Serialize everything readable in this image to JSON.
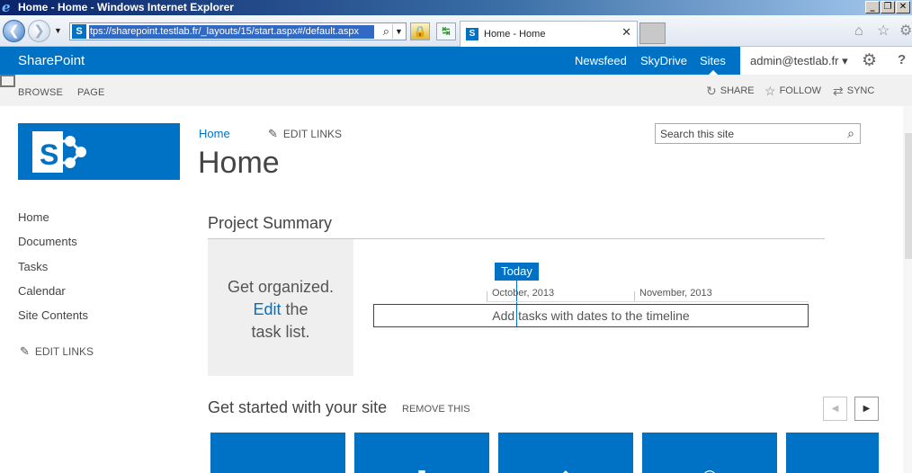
{
  "browser": {
    "window_title": "Home - Home - Windows Internet Explorer",
    "window_buttons": {
      "minimize": "_",
      "restore": "❐",
      "close": "✕"
    },
    "address_url": "tps://sharepoint.testlab.fr/_layouts/15/start.aspx#/default.aspx",
    "site_favicon": "S",
    "tab_title": "Home - Home",
    "tab_close": "✕",
    "back_glyph": "❮",
    "forward_glyph": "❯",
    "dropdown_glyph": "▼",
    "lock_glyph": "🔒",
    "compat_glyph": "↹",
    "search_glyph": "⌕",
    "home_glyph": "⌂",
    "favorites_glyph": "☆",
    "tools_glyph": "⚙"
  },
  "suite_bar": {
    "brand": "SharePoint",
    "links": [
      "Newsfeed",
      "SkyDrive",
      "Sites"
    ],
    "user": "admin@testlab.fr ▾",
    "settings_glyph": "⚙",
    "help_glyph": "?",
    "color": "#0072c6"
  },
  "ribbon": {
    "tabs": [
      "BROWSE",
      "PAGE"
    ],
    "actions": [
      {
        "label": "SHARE",
        "icon": "↻"
      },
      {
        "label": "FOLLOW",
        "icon": "☆"
      },
      {
        "label": "SYNC",
        "icon": "⇄"
      }
    ]
  },
  "header": {
    "breadcrumb_home": "Home",
    "edit_links": "EDIT LINKS",
    "edit_glyph": "✎",
    "page_title": "Home",
    "search_placeholder": "Search this site",
    "search_icon": "⌕"
  },
  "left_nav": {
    "items": [
      "Home",
      "Documents",
      "Tasks",
      "Calendar",
      "Site Contents"
    ],
    "edit_links": "EDIT LINKS"
  },
  "project_summary": {
    "title": "Project Summary",
    "msg_line1": "Get organized.",
    "msg_edit": "Edit",
    "msg_line2_rest": " the",
    "msg_line3": "task list.",
    "today": "Today",
    "months": [
      "October, 2013",
      "November, 2013"
    ],
    "timeline_placeholder": "Add tasks with dates to the timeline"
  },
  "get_started": {
    "title": "Get started with your site",
    "remove": "REMOVE THIS",
    "prev_glyph": "◀",
    "next_glyph": "▶",
    "tile_glyphs": [
      "☁",
      "▮",
      "◆",
      "◎",
      ""
    ]
  }
}
